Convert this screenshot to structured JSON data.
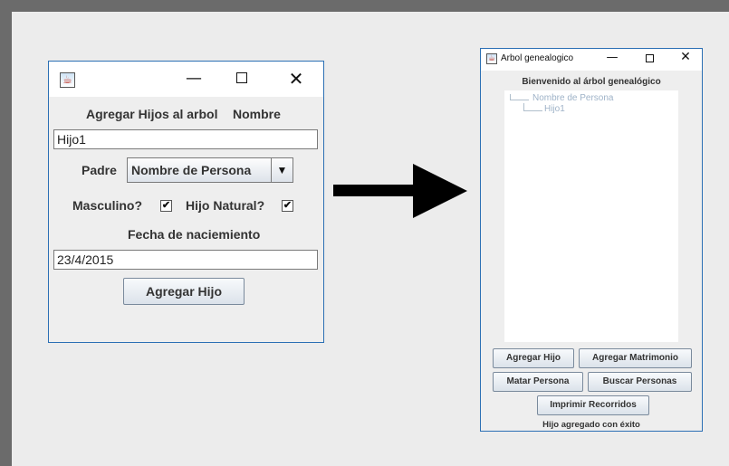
{
  "dialog": {
    "title_label": "Agregar Hijos al arbol",
    "nombre_label": "Nombre",
    "nombre_value": "Hijo1",
    "padre_label": "Padre",
    "padre_selected": "Nombre de Persona",
    "masculino_label": "Masculino?",
    "masculino_checked": true,
    "hijo_natural_label": "Hijo Natural?",
    "hijo_natural_checked": true,
    "fecha_label": "Fecha de naciemiento",
    "fecha_value": "23/4/2015",
    "submit_label": "Agregar Hijo",
    "window_controls": {
      "minimize": "—",
      "maximize": "☐",
      "close": "✕"
    }
  },
  "main_window": {
    "title": "Arbol genealogico",
    "welcome": "Bienvenido al árbol genealógico",
    "tree": {
      "root": "Nombre de Persona",
      "child": "Hijo1"
    },
    "buttons": {
      "agregar_hijo": "Agregar Hijo",
      "agregar_matrimonio": "Agregar Matrimonio",
      "matar_persona": "Matar Persona",
      "buscar_personas": "Buscar Personas",
      "imprimir_recorridos": "Imprimir Recorridos"
    },
    "status": "Hijo agregado con éxito"
  },
  "icons": {
    "app_icon": "java-cup-icon",
    "arrow": "right-arrow-icon",
    "check": "check-icon",
    "dropdown": "chevron-down-icon"
  },
  "colors": {
    "window_border": "#2b6fb4",
    "tree_text": "#9fb3c8",
    "background": "#ececec"
  }
}
